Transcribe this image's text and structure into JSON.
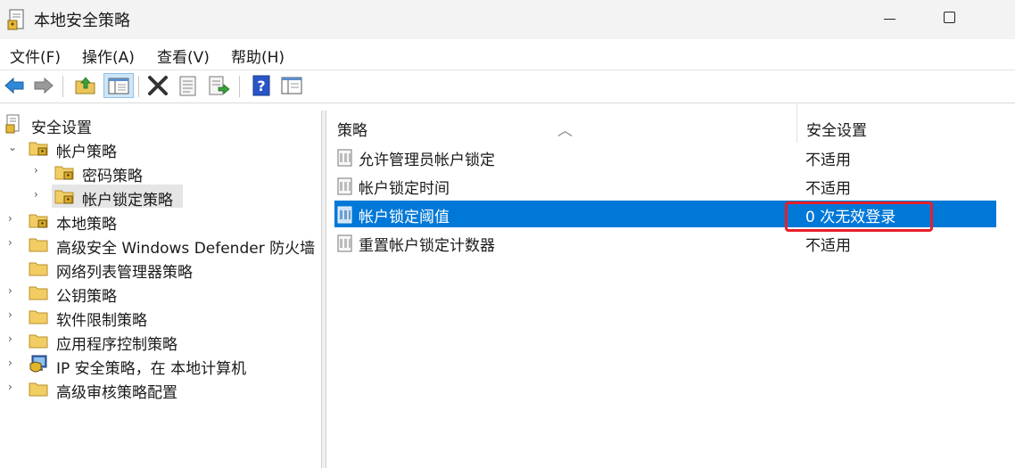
{
  "window": {
    "title": "本地安全策略"
  },
  "menu": [
    "文件(F)",
    "操作(A)",
    "查看(V)",
    "帮助(H)"
  ],
  "toolbar": {
    "buttons": [
      "back-arrow-icon",
      "forward-arrow-icon",
      "up-folder-icon",
      "show-hide-tree-icon",
      "delete-icon",
      "properties-icon",
      "export-list-icon",
      "help-icon",
      "console-view-icon"
    ]
  },
  "tree": {
    "root": "安全设置",
    "items": [
      {
        "label": "帐户策略",
        "level": 1,
        "expanded": true
      },
      {
        "label": "密码策略",
        "level": 2
      },
      {
        "label": "帐户锁定策略",
        "level": 2,
        "selected": true
      },
      {
        "label": "本地策略",
        "level": 1
      },
      {
        "label": "高级安全 Windows Defender 防火墙",
        "level": 1
      },
      {
        "label": "网络列表管理器策略",
        "level": 1
      },
      {
        "label": "公钥策略",
        "level": 1
      },
      {
        "label": "软件限制策略",
        "level": 1
      },
      {
        "label": "应用程序控制策略",
        "level": 1
      },
      {
        "label": "IP 安全策略，在 本地计算机",
        "level": 1
      },
      {
        "label": "高级审核策略配置",
        "level": 1
      }
    ]
  },
  "list": {
    "columns": [
      "策略",
      "安全设置"
    ],
    "rows": [
      {
        "policy": "允许管理员帐户锁定",
        "setting": "不适用"
      },
      {
        "policy": "帐户锁定时间",
        "setting": "不适用"
      },
      {
        "policy": "帐户锁定阈值",
        "setting": "0 次无效登录",
        "selected": true
      },
      {
        "policy": "重置帐户锁定计数器",
        "setting": "不适用"
      }
    ]
  },
  "colors": {
    "selection": "#0078d7",
    "highlight_box": "#e81f2a"
  }
}
